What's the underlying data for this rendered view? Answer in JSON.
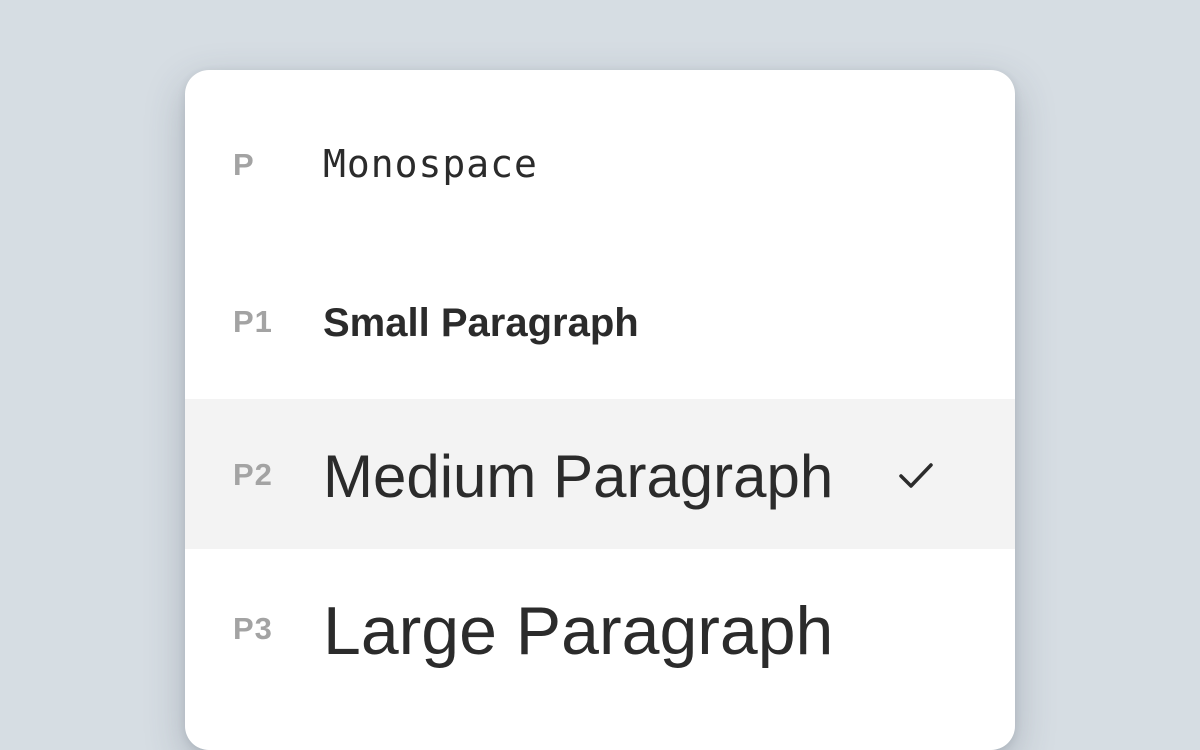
{
  "menu": {
    "items": [
      {
        "code": "P",
        "label": "Monospace",
        "selected": false
      },
      {
        "code": "P1",
        "label": "Small Paragraph",
        "selected": false
      },
      {
        "code": "P2",
        "label": "Medium Paragraph",
        "selected": true
      },
      {
        "code": "P3",
        "label": "Large Paragraph",
        "selected": false
      }
    ]
  },
  "icons": {
    "selected_indicator": "checkmark-icon"
  },
  "colors": {
    "background": "#d6dde3",
    "menu_background": "#ffffff",
    "selected_row": "#f3f3f3",
    "code_text": "#a3a3a3",
    "label_text": "#2b2b2b"
  }
}
